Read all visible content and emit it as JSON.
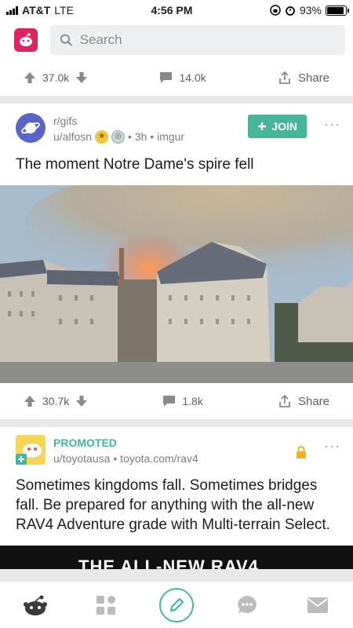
{
  "status_bar": {
    "carrier": "AT&T",
    "network": "LTE",
    "time": "4:56 PM",
    "battery": "93%",
    "battery_level": 0.93
  },
  "header": {
    "search_placeholder": "Search"
  },
  "prev_post": {
    "upvotes": "37.0k",
    "comments": "14.0k",
    "share": "Share"
  },
  "post": {
    "subreddit": "r/gifs",
    "user": "u/alfosn",
    "meta": "• 3h • imgur",
    "join_label": "JOIN",
    "title": "The moment Notre Dame's spire fell",
    "upvotes": "30.7k",
    "comments": "1.8k",
    "share": "Share"
  },
  "promo": {
    "label": "PROMOTED",
    "user": "u/toyotausa",
    "domain": "• toyota.com/rav4",
    "title": "Sometimes kingdoms fall. Sometimes bridges fall. Be prepared for anything with the all-new RAV4 Adventure grade with Multi-terrain Select.",
    "video_text": "THE ALL-NEW RAV4"
  },
  "colors": {
    "accent": "#46b59a",
    "brand": "#e0245e",
    "sub_avatar": "#5a64c8"
  },
  "tabs": [
    "home-icon",
    "communities-icon",
    "compose-icon",
    "chat-icon",
    "inbox-icon"
  ]
}
